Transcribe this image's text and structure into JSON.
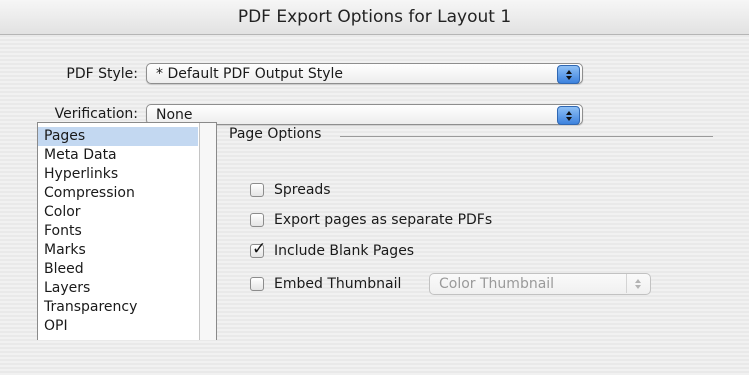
{
  "window": {
    "title": "PDF Export Options for Layout 1"
  },
  "pdf_style": {
    "label": "PDF Style:",
    "value": "* Default PDF Output Style"
  },
  "verification": {
    "label": "Verification:",
    "value": "None"
  },
  "sidebar": {
    "items": [
      {
        "label": "Pages",
        "selected": true
      },
      {
        "label": "Meta Data"
      },
      {
        "label": "Hyperlinks"
      },
      {
        "label": "Compression"
      },
      {
        "label": "Color"
      },
      {
        "label": "Fonts"
      },
      {
        "label": "Marks"
      },
      {
        "label": "Bleed"
      },
      {
        "label": "Layers"
      },
      {
        "label": "Transparency"
      },
      {
        "label": "OPI"
      }
    ]
  },
  "page_options": {
    "title": "Page Options",
    "spreads": {
      "label": "Spreads",
      "checked": false
    },
    "separate": {
      "label": "Export pages as separate PDFs",
      "checked": false
    },
    "blank": {
      "label": "Include Blank Pages",
      "checked": true
    },
    "thumbnail": {
      "label": "Embed Thumbnail",
      "checked": false,
      "select_value": "Color Thumbnail",
      "select_enabled": false
    }
  }
}
